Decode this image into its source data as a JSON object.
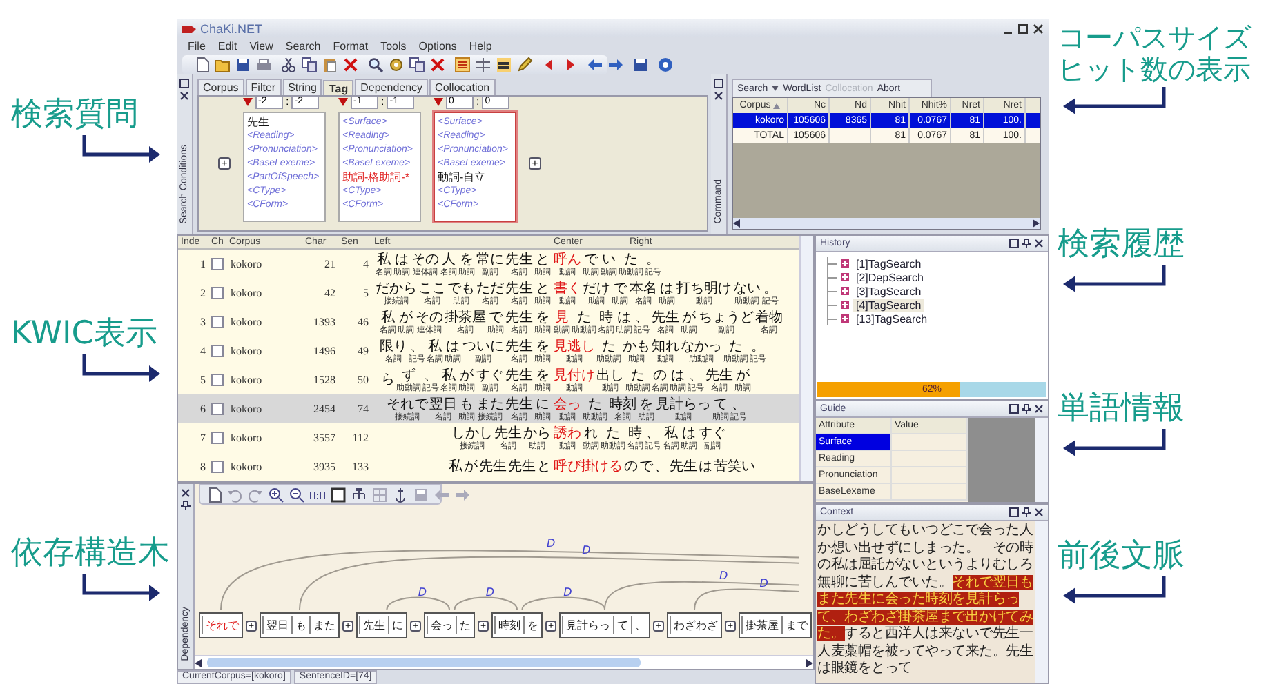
{
  "annotations": {
    "left": [
      {
        "lines": [
          "検索質問"
        ]
      },
      {
        "lines": [
          "KWIC表示"
        ]
      },
      {
        "lines": [
          "依存構造木"
        ]
      }
    ],
    "right": [
      {
        "lines": [
          "コーパスサイズ",
          "ヒット数の表示"
        ]
      },
      {
        "lines": [
          "検索履歴"
        ]
      },
      {
        "lines": [
          "単語情報"
        ]
      },
      {
        "lines": [
          "前後文脈"
        ]
      }
    ]
  },
  "window": {
    "title": "ChaKi.NET"
  },
  "menu": [
    "File",
    "Edit",
    "View",
    "Search",
    "Format",
    "Tools",
    "Options",
    "Help"
  ],
  "search_conditions": {
    "side_label": "Search Conditions",
    "tabs": [
      {
        "label": "Corpus",
        "selected": false
      },
      {
        "label": "Filter",
        "selected": false
      },
      {
        "label": "String",
        "selected": false
      },
      {
        "label": "Tag",
        "selected": true
      },
      {
        "label": "Dependency",
        "selected": false
      },
      {
        "label": "Collocation",
        "selected": false
      }
    ],
    "add_left": "+",
    "add_right": "+",
    "boxes": [
      {
        "selected": false,
        "range_from": "-2",
        "range_to": "-2",
        "separator": ":",
        "lines": [
          {
            "text": "先生",
            "kind": "value"
          },
          {
            "text": "<Reading>",
            "kind": "placeholder"
          },
          {
            "text": "<Pronunciation>",
            "kind": "placeholder"
          },
          {
            "text": "<BaseLexeme>",
            "kind": "placeholder"
          },
          {
            "text": "<PartOfSpeech>",
            "kind": "placeholder"
          },
          {
            "text": "<CType>",
            "kind": "placeholder"
          },
          {
            "text": "<CForm>",
            "kind": "placeholder"
          }
        ]
      },
      {
        "selected": false,
        "range_from": "-1",
        "range_to": "-1",
        "separator": ":",
        "lines": [
          {
            "text": "<Surface>",
            "kind": "placeholder"
          },
          {
            "text": "<Reading>",
            "kind": "placeholder"
          },
          {
            "text": "<Pronunciation>",
            "kind": "placeholder"
          },
          {
            "text": "<BaseLexeme>",
            "kind": "placeholder"
          },
          {
            "text": "助詞-格助詞-*",
            "kind": "warning"
          },
          {
            "text": "<CType>",
            "kind": "placeholder"
          },
          {
            "text": "<CForm>",
            "kind": "placeholder"
          }
        ]
      },
      {
        "selected": true,
        "range_from": "0",
        "range_to": "0",
        "separator": ":",
        "lines": [
          {
            "text": "<Surface>",
            "kind": "placeholder"
          },
          {
            "text": "<Reading>",
            "kind": "placeholder"
          },
          {
            "text": "<Pronunciation>",
            "kind": "placeholder"
          },
          {
            "text": "<BaseLexeme>",
            "kind": "placeholder"
          },
          {
            "text": "動詞-自立",
            "kind": "value"
          },
          {
            "text": "<CType>",
            "kind": "placeholder"
          },
          {
            "text": "<CForm>",
            "kind": "placeholder"
          }
        ]
      }
    ]
  },
  "command": {
    "side_label": "Command",
    "toolbar": [
      {
        "label": "Search",
        "disabled": false,
        "dropdown": true
      },
      {
        "label": "WordList",
        "disabled": false,
        "dropdown": false
      },
      {
        "label": "Collocation",
        "disabled": true,
        "dropdown": false
      },
      {
        "label": "Abort",
        "disabled": false,
        "dropdown": false
      }
    ],
    "columns": [
      "Corpus",
      "Nc",
      "Nd",
      "Nhit",
      "Nhit%",
      "Nret",
      "Nret"
    ],
    "rows": [
      {
        "selected": true,
        "cells": [
          "kokoro",
          "105606",
          "8365",
          "81",
          "0.0767",
          "81",
          "100."
        ]
      },
      {
        "selected": false,
        "cells": [
          "TOTAL",
          "105606",
          "",
          "81",
          "0.0767",
          "81",
          "100."
        ]
      }
    ]
  },
  "kwic": {
    "columns": [
      "Inde",
      "Ch",
      "Corpus",
      "Char",
      "Sen",
      "Left",
      "Center",
      "Right"
    ],
    "rows": [
      {
        "index": "1",
        "checked": false,
        "corpus": "kokoro",
        "char": "21",
        "sen": "4",
        "selected": false,
        "left": [
          {
            "w": "私",
            "pos": "名詞"
          },
          {
            "w": "は",
            "pos": "助詞"
          },
          {
            "w": "その",
            "pos": "連体詞"
          },
          {
            "w": "人",
            "pos": "名詞"
          },
          {
            "w": "を",
            "pos": "助詞"
          },
          {
            "w": "常に",
            "pos": "副詞"
          },
          {
            "w": "先生",
            "pos": "名詞"
          },
          {
            "w": "と",
            "pos": "助詞"
          }
        ],
        "center": {
          "w": "呼ん",
          "pos": "動詞"
        },
        "right": [
          {
            "w": "で",
            "pos": "助詞"
          },
          {
            "w": "い",
            "pos": "動詞"
          },
          {
            "w": "た",
            "pos": "助動詞"
          },
          {
            "w": "。",
            "pos": "記号"
          }
        ]
      },
      {
        "index": "2",
        "checked": false,
        "corpus": "kokoro",
        "char": "42",
        "sen": "5",
        "selected": false,
        "left": [
          {
            "w": "だから",
            "pos": "接続詞"
          },
          {
            "w": "ここ",
            "pos": "名詞"
          },
          {
            "w": "でも",
            "pos": "助詞"
          },
          {
            "w": "ただ",
            "pos": "名詞"
          },
          {
            "w": "先生",
            "pos": "名詞"
          },
          {
            "w": "と",
            "pos": "助詞"
          }
        ],
        "center": {
          "w": "書く",
          "pos": "動詞"
        },
        "right": [
          {
            "w": "だけ",
            "pos": "助詞"
          },
          {
            "w": "で",
            "pos": "助詞"
          },
          {
            "w": "本名",
            "pos": "名詞"
          },
          {
            "w": "は",
            "pos": "助詞"
          },
          {
            "w": "打ち明け",
            "pos": "動詞"
          },
          {
            "w": "ない",
            "pos": "助動詞"
          },
          {
            "w": "。",
            "pos": "記号"
          }
        ]
      },
      {
        "index": "3",
        "checked": false,
        "corpus": "kokoro",
        "char": "1393",
        "sen": "46",
        "selected": false,
        "left": [
          {
            "w": "私",
            "pos": "名詞"
          },
          {
            "w": "が",
            "pos": "助詞"
          },
          {
            "w": "その",
            "pos": "連体詞"
          },
          {
            "w": "掛茶屋",
            "pos": "名詞"
          },
          {
            "w": "で",
            "pos": "助詞"
          },
          {
            "w": "先生",
            "pos": "名詞"
          },
          {
            "w": "を",
            "pos": "助詞"
          }
        ],
        "center": {
          "w": "見",
          "pos": "動詞"
        },
        "right": [
          {
            "w": "た",
            "pos": "助動詞"
          },
          {
            "w": "時",
            "pos": "名詞"
          },
          {
            "w": "は",
            "pos": "助詞"
          },
          {
            "w": "、",
            "pos": "記号"
          },
          {
            "w": "先生",
            "pos": "名詞"
          },
          {
            "w": "が",
            "pos": "助詞"
          },
          {
            "w": "ちょうど",
            "pos": "副詞"
          },
          {
            "w": "着物",
            "pos": "名詞"
          }
        ]
      },
      {
        "index": "4",
        "checked": false,
        "corpus": "kokoro",
        "char": "1496",
        "sen": "49",
        "selected": false,
        "left": [
          {
            "w": "限り",
            "pos": "名詞"
          },
          {
            "w": "、",
            "pos": "記号"
          },
          {
            "w": "私",
            "pos": "名詞"
          },
          {
            "w": "は",
            "pos": "助詞"
          },
          {
            "w": "ついに",
            "pos": "副詞"
          },
          {
            "w": "先生",
            "pos": "名詞"
          },
          {
            "w": "を",
            "pos": "助詞"
          }
        ],
        "center": {
          "w": "見逃し",
          "pos": "動詞"
        },
        "right": [
          {
            "w": "た",
            "pos": "助動詞"
          },
          {
            "w": "かも",
            "pos": "助詞"
          },
          {
            "w": "知れ",
            "pos": "動詞"
          },
          {
            "w": "なかっ",
            "pos": "助動詞"
          },
          {
            "w": "た",
            "pos": "助動詞"
          },
          {
            "w": "。",
            "pos": "記号"
          }
        ]
      },
      {
        "index": "5",
        "checked": false,
        "corpus": "kokoro",
        "char": "1528",
        "sen": "50",
        "selected": false,
        "left": [
          {
            "w": "ら"
          },
          {
            "w": "ず",
            "pos": "助動詞"
          },
          {
            "w": "、",
            "pos": "記号"
          },
          {
            "w": "私",
            "pos": "名詞"
          },
          {
            "w": "が",
            "pos": "助詞"
          },
          {
            "w": "すぐ",
            "pos": "副詞"
          },
          {
            "w": "先生",
            "pos": "名詞"
          },
          {
            "w": "を",
            "pos": "助詞"
          }
        ],
        "center": {
          "w": "見付け",
          "pos": "動詞"
        },
        "right": [
          {
            "w": "出し",
            "pos": "動詞"
          },
          {
            "w": "た",
            "pos": "助動詞"
          },
          {
            "w": "の",
            "pos": "名詞"
          },
          {
            "w": "は",
            "pos": "助詞"
          },
          {
            "w": "、",
            "pos": "記号"
          },
          {
            "w": "先生",
            "pos": "名詞"
          },
          {
            "w": "が",
            "pos": "助詞"
          }
        ]
      },
      {
        "index": "6",
        "checked": false,
        "corpus": "kokoro",
        "char": "2454",
        "sen": "74",
        "selected": true,
        "left": [
          {
            "w": "それで",
            "pos": "接続詞"
          },
          {
            "w": "翌日",
            "pos": "名詞"
          },
          {
            "w": "も",
            "pos": "助詞"
          },
          {
            "w": "また",
            "pos": "接続詞"
          },
          {
            "w": "先生",
            "pos": "名詞"
          },
          {
            "w": "に",
            "pos": "助詞"
          }
        ],
        "center": {
          "w": "会っ",
          "pos": "動詞"
        },
        "right": [
          {
            "w": "た",
            "pos": "助動詞"
          },
          {
            "w": "時刻",
            "pos": "名詞"
          },
          {
            "w": "を",
            "pos": "助詞"
          },
          {
            "w": "見計らっ",
            "pos": "動詞"
          },
          {
            "w": "て",
            "pos": "助詞"
          },
          {
            "w": "、",
            "pos": "記号"
          }
        ]
      },
      {
        "index": "7",
        "checked": false,
        "corpus": "kokoro",
        "char": "3557",
        "sen": "112",
        "selected": false,
        "left": [
          {
            "w": "しかし",
            "pos": "接続詞"
          },
          {
            "w": "先生",
            "pos": "名詞"
          },
          {
            "w": "から",
            "pos": "助詞"
          }
        ],
        "center": {
          "w": "誘わ",
          "pos": "動詞"
        },
        "right": [
          {
            "w": "れ",
            "pos": "動詞"
          },
          {
            "w": "た",
            "pos": "助動詞"
          },
          {
            "w": "時",
            "pos": "名詞"
          },
          {
            "w": "、",
            "pos": "記号"
          },
          {
            "w": "私",
            "pos": "名詞"
          },
          {
            "w": "は",
            "pos": "助詞"
          },
          {
            "w": "すぐ",
            "pos": "副詞"
          }
        ]
      },
      {
        "index": "8",
        "checked": false,
        "corpus": "kokoro",
        "char": "3935",
        "sen": "133",
        "selected": false,
        "left": [
          {
            "w": "私"
          },
          {
            "w": "が"
          },
          {
            "w": "先生"
          },
          {
            "w": "先生"
          },
          {
            "w": "と"
          }
        ],
        "center": {
          "w": "呼び掛ける"
        },
        "right": [
          {
            "w": "の"
          },
          {
            "w": "で"
          },
          {
            "w": "、"
          },
          {
            "w": "先生"
          },
          {
            "w": "は"
          },
          {
            "w": "苦笑い"
          }
        ]
      }
    ]
  },
  "history": {
    "title": "History",
    "items": [
      {
        "label": "[1]TagSearch",
        "selected": false
      },
      {
        "label": "[2]DepSearch",
        "selected": false
      },
      {
        "label": "[3]TagSearch",
        "selected": false
      },
      {
        "label": "[4]TagSearch",
        "selected": true
      },
      {
        "label": "[13]TagSearch",
        "selected": false
      }
    ],
    "progress": {
      "level": 0.62,
      "label": "62%"
    }
  },
  "guide": {
    "title": "Guide",
    "columns": [
      "Attribute",
      "Value"
    ],
    "rows": [
      {
        "attribute": "Surface",
        "selected": true
      },
      {
        "attribute": "Reading",
        "selected": false
      },
      {
        "attribute": "Pronunciation",
        "selected": false
      },
      {
        "attribute": "BaseLexeme",
        "selected": false
      }
    ]
  },
  "context": {
    "title": "Context",
    "segments": [
      {
        "text": "かしどうしてもいつどこで会った人か想い出せずにしまった。　その時の私は屈託がないというよりむしろ無聊に苦しんでいた。",
        "highlight": false
      },
      {
        "text": "それで翌日もまた先生に会った時刻を見計らって、わざわざ掛茶屋まで出かけてみた。",
        "highlight": true
      },
      {
        "text": "すると西洋人は来ないで先生一人麦藁帽を被ってやって来た。先生は眼鏡をとって",
        "highlight": false
      }
    ]
  },
  "dependency": {
    "side_label": "Dependency",
    "chunks": [
      {
        "words": [
          {
            "text": "それで",
            "selected": true
          }
        ],
        "join_button": "+",
        "link": {
          "label": "D",
          "kind": "beyond"
        }
      },
      {
        "words": [
          {
            "text": "翌日",
            "selected": false
          },
          {
            "text": "も",
            "selected": false
          },
          {
            "text": "また",
            "selected": false
          }
        ],
        "join_button": "+",
        "link": {
          "label": "D",
          "kind": "beyond"
        }
      },
      {
        "words": [
          {
            "text": "先生",
            "selected": false
          },
          {
            "text": "に",
            "selected": false
          }
        ],
        "join_button": "+",
        "link": {
          "label": "D",
          "kind": "next"
        }
      },
      {
        "words": [
          {
            "text": "会っ",
            "selected": false
          },
          {
            "text": "た",
            "selected": false
          }
        ],
        "join_button": "+",
        "link": {
          "label": "D",
          "kind": "next"
        }
      },
      {
        "words": [
          {
            "text": "時刻",
            "selected": false
          },
          {
            "text": "を",
            "selected": false
          }
        ],
        "join_button": "+",
        "link": {
          "label": "D",
          "kind": "next"
        }
      },
      {
        "words": [
          {
            "text": "見計らっ",
            "selected": false
          },
          {
            "text": "て",
            "selected": false
          },
          {
            "text": "、",
            "selected": false
          }
        ],
        "join_button": "+",
        "link": {
          "label": "D",
          "kind": "beyond"
        }
      },
      {
        "words": [
          {
            "text": "わざわざ",
            "selected": false
          }
        ],
        "join_button": "+",
        "link": {
          "label": "D",
          "kind": "beyond"
        }
      },
      {
        "words": [
          {
            "text": "掛茶屋",
            "selected": false
          },
          {
            "text": "まで",
            "selected": false
          }
        ]
      }
    ]
  },
  "status_bar": [
    "CurrentCorpus=[kokoro]",
    "SentenceID=[74]"
  ]
}
